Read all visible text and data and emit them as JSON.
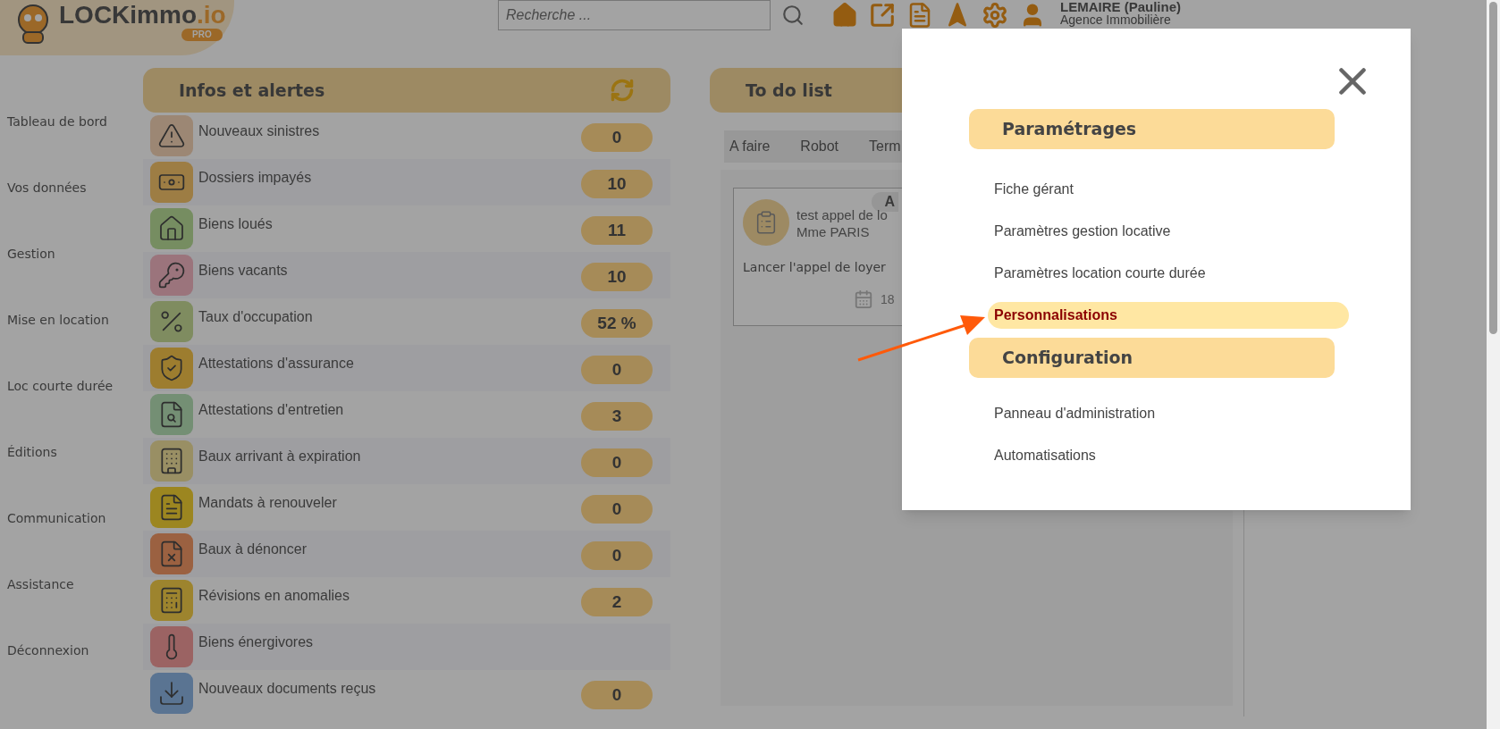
{
  "header": {
    "logo": {
      "name": "LOCKimmo",
      "suffix": ".io",
      "badge": "PRO"
    },
    "search": {
      "placeholder": "Recherche ..."
    },
    "user": {
      "name": "LEMAIRE (Pauline)",
      "agency": "Agence Immobilière"
    }
  },
  "sidebar": {
    "items": [
      "Tableau de bord",
      "Vos données",
      "Gestion",
      "Mise en location",
      "Loc courte durée",
      "Éditions",
      "Communication",
      "Assistance",
      "Déconnexion"
    ]
  },
  "infos": {
    "title": "Infos et alertes",
    "rows": [
      {
        "label": "Nouveaux sinistres",
        "count": "0",
        "color": "#9c8774"
      },
      {
        "label": "Dossiers impayés",
        "count": "10",
        "color": "#9d7d44"
      },
      {
        "label": "Biens loués",
        "count": "11",
        "color": "#768d61"
      },
      {
        "label": "Biens vacants",
        "count": "10",
        "color": "#9b747c"
      },
      {
        "label": "Taux d'occupation",
        "count": "52 %",
        "color": "#7f8c60"
      },
      {
        "label": "Attestations d'assurance",
        "count": "0",
        "color": "#9d7d2f"
      },
      {
        "label": "Attestations d'entretien",
        "count": "3",
        "color": "#748f74"
      },
      {
        "label": "Baux arrivant à expiration",
        "count": "0",
        "color": "#998f64"
      },
      {
        "label": "Mandats à renouveler",
        "count": "0",
        "color": "#9c8620"
      },
      {
        "label": "Baux à dénoncer",
        "count": "0",
        "color": "#9b6141"
      },
      {
        "label": "Révisions en anomalies",
        "count": "2",
        "color": "#9d842e"
      },
      {
        "label": "Biens énergivores",
        "color": "#9b6363"
      },
      {
        "label": "Nouveaux documents reçus",
        "count": "0",
        "color": "#5a7492"
      }
    ]
  },
  "todo": {
    "title": "To do list",
    "tabs": [
      "A faire",
      "Robot",
      "Term"
    ],
    "card": {
      "badge": "A",
      "title": "test appel de lo",
      "person": "Mme PARIS",
      "task": "Lancer l'appel de loyer",
      "date": "18"
    }
  },
  "modal": {
    "sections": [
      {
        "title": "Paramétrages",
        "items": [
          {
            "label": "Fiche gérant",
            "selected": false
          },
          {
            "label": "Paramètres gestion locative",
            "selected": false
          },
          {
            "label": "Paramètres location courte durée",
            "selected": false
          },
          {
            "label": "Personnalisations",
            "selected": true
          }
        ]
      },
      {
        "title": "Configuration",
        "items": [
          {
            "label": "Panneau d'administration",
            "selected": false
          },
          {
            "label": "Automatisations",
            "selected": false
          }
        ]
      }
    ]
  }
}
